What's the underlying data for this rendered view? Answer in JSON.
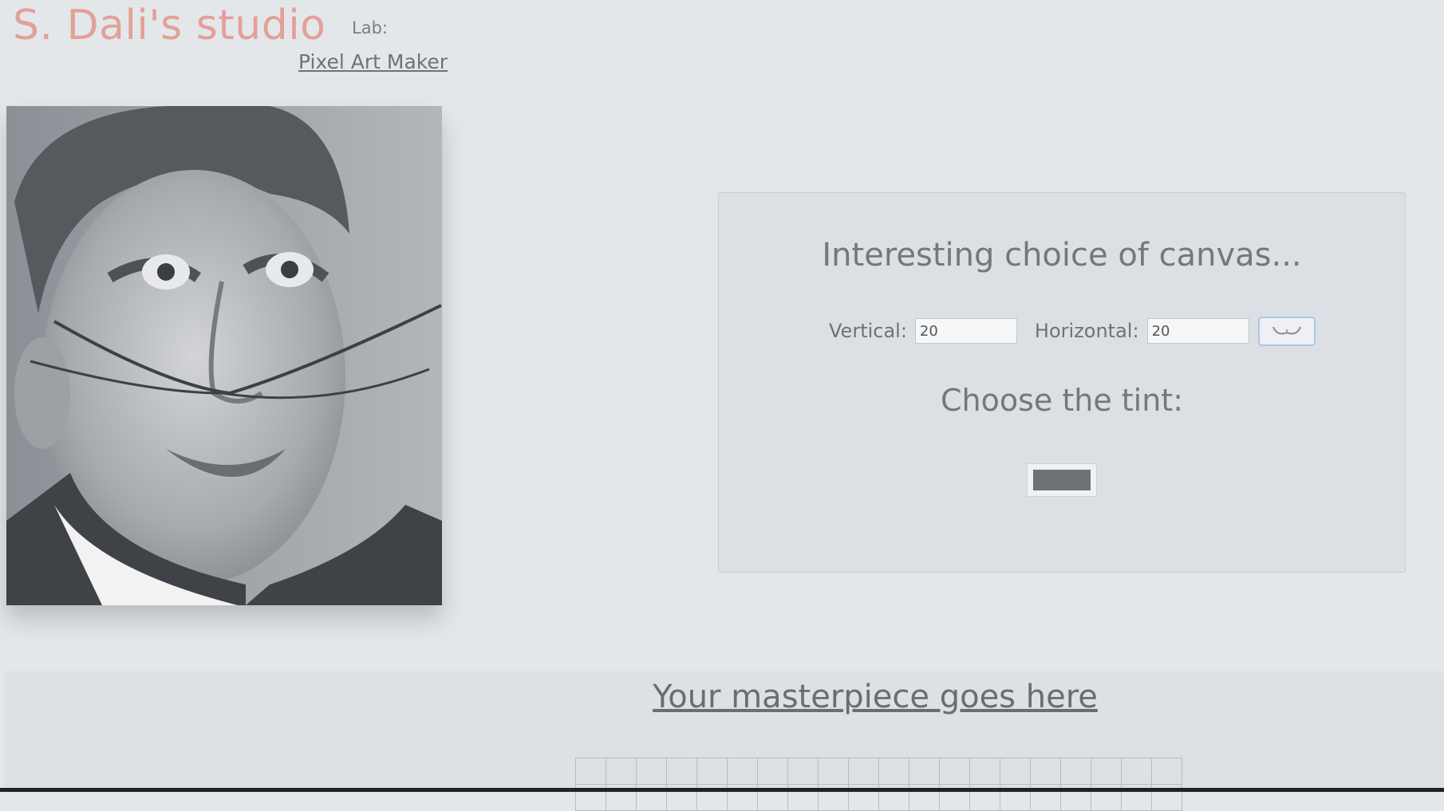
{
  "header": {
    "brand": "S. Dali's studio",
    "lab_label": "Lab:",
    "lab_link": "Pixel Art Maker"
  },
  "form": {
    "title": "Interesting choice of canvas...",
    "vertical_label": "Vertical:",
    "vertical_value": "20",
    "horizontal_label": "Horizontal:",
    "horizontal_value": "20",
    "submit_icon": "mustache-icon",
    "tint_title": "Choose the tint:",
    "tint_color": "#6e7176"
  },
  "canvas": {
    "title": "Your masterpiece goes here",
    "columns": 20,
    "visible_rows": 2
  },
  "colors": {
    "background": "#e4e7ea",
    "brand": "#e2a198",
    "panel": "#dcdfe3",
    "button_focus": "#a9c7ea"
  }
}
